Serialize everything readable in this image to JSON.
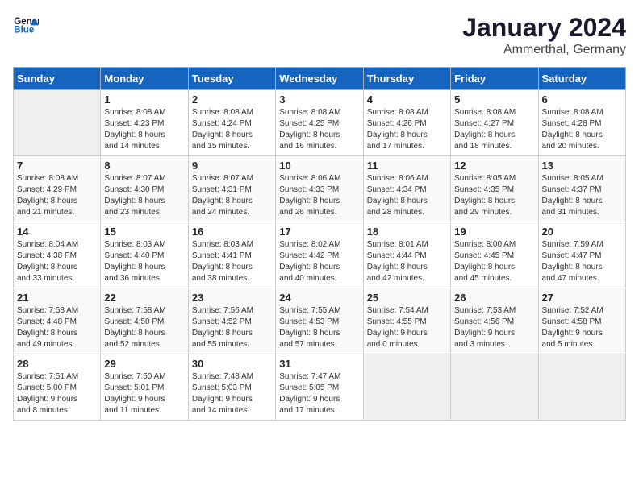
{
  "header": {
    "logo_general": "General",
    "logo_blue": "Blue",
    "title": "January 2024",
    "subtitle": "Ammerthal, Germany"
  },
  "days_of_week": [
    "Sunday",
    "Monday",
    "Tuesday",
    "Wednesday",
    "Thursday",
    "Friday",
    "Saturday"
  ],
  "weeks": [
    [
      {
        "day": "",
        "info": ""
      },
      {
        "day": "1",
        "info": "Sunrise: 8:08 AM\nSunset: 4:23 PM\nDaylight: 8 hours\nand 14 minutes."
      },
      {
        "day": "2",
        "info": "Sunrise: 8:08 AM\nSunset: 4:24 PM\nDaylight: 8 hours\nand 15 minutes."
      },
      {
        "day": "3",
        "info": "Sunrise: 8:08 AM\nSunset: 4:25 PM\nDaylight: 8 hours\nand 16 minutes."
      },
      {
        "day": "4",
        "info": "Sunrise: 8:08 AM\nSunset: 4:26 PM\nDaylight: 8 hours\nand 17 minutes."
      },
      {
        "day": "5",
        "info": "Sunrise: 8:08 AM\nSunset: 4:27 PM\nDaylight: 8 hours\nand 18 minutes."
      },
      {
        "day": "6",
        "info": "Sunrise: 8:08 AM\nSunset: 4:28 PM\nDaylight: 8 hours\nand 20 minutes."
      }
    ],
    [
      {
        "day": "7",
        "info": "Sunrise: 8:08 AM\nSunset: 4:29 PM\nDaylight: 8 hours\nand 21 minutes."
      },
      {
        "day": "8",
        "info": "Sunrise: 8:07 AM\nSunset: 4:30 PM\nDaylight: 8 hours\nand 23 minutes."
      },
      {
        "day": "9",
        "info": "Sunrise: 8:07 AM\nSunset: 4:31 PM\nDaylight: 8 hours\nand 24 minutes."
      },
      {
        "day": "10",
        "info": "Sunrise: 8:06 AM\nSunset: 4:33 PM\nDaylight: 8 hours\nand 26 minutes."
      },
      {
        "day": "11",
        "info": "Sunrise: 8:06 AM\nSunset: 4:34 PM\nDaylight: 8 hours\nand 28 minutes."
      },
      {
        "day": "12",
        "info": "Sunrise: 8:05 AM\nSunset: 4:35 PM\nDaylight: 8 hours\nand 29 minutes."
      },
      {
        "day": "13",
        "info": "Sunrise: 8:05 AM\nSunset: 4:37 PM\nDaylight: 8 hours\nand 31 minutes."
      }
    ],
    [
      {
        "day": "14",
        "info": "Sunrise: 8:04 AM\nSunset: 4:38 PM\nDaylight: 8 hours\nand 33 minutes."
      },
      {
        "day": "15",
        "info": "Sunrise: 8:03 AM\nSunset: 4:40 PM\nDaylight: 8 hours\nand 36 minutes."
      },
      {
        "day": "16",
        "info": "Sunrise: 8:03 AM\nSunset: 4:41 PM\nDaylight: 8 hours\nand 38 minutes."
      },
      {
        "day": "17",
        "info": "Sunrise: 8:02 AM\nSunset: 4:42 PM\nDaylight: 8 hours\nand 40 minutes."
      },
      {
        "day": "18",
        "info": "Sunrise: 8:01 AM\nSunset: 4:44 PM\nDaylight: 8 hours\nand 42 minutes."
      },
      {
        "day": "19",
        "info": "Sunrise: 8:00 AM\nSunset: 4:45 PM\nDaylight: 8 hours\nand 45 minutes."
      },
      {
        "day": "20",
        "info": "Sunrise: 7:59 AM\nSunset: 4:47 PM\nDaylight: 8 hours\nand 47 minutes."
      }
    ],
    [
      {
        "day": "21",
        "info": "Sunrise: 7:58 AM\nSunset: 4:48 PM\nDaylight: 8 hours\nand 49 minutes."
      },
      {
        "day": "22",
        "info": "Sunrise: 7:58 AM\nSunset: 4:50 PM\nDaylight: 8 hours\nand 52 minutes."
      },
      {
        "day": "23",
        "info": "Sunrise: 7:56 AM\nSunset: 4:52 PM\nDaylight: 8 hours\nand 55 minutes."
      },
      {
        "day": "24",
        "info": "Sunrise: 7:55 AM\nSunset: 4:53 PM\nDaylight: 8 hours\nand 57 minutes."
      },
      {
        "day": "25",
        "info": "Sunrise: 7:54 AM\nSunset: 4:55 PM\nDaylight: 9 hours\nand 0 minutes."
      },
      {
        "day": "26",
        "info": "Sunrise: 7:53 AM\nSunset: 4:56 PM\nDaylight: 9 hours\nand 3 minutes."
      },
      {
        "day": "27",
        "info": "Sunrise: 7:52 AM\nSunset: 4:58 PM\nDaylight: 9 hours\nand 5 minutes."
      }
    ],
    [
      {
        "day": "28",
        "info": "Sunrise: 7:51 AM\nSunset: 5:00 PM\nDaylight: 9 hours\nand 8 minutes."
      },
      {
        "day": "29",
        "info": "Sunrise: 7:50 AM\nSunset: 5:01 PM\nDaylight: 9 hours\nand 11 minutes."
      },
      {
        "day": "30",
        "info": "Sunrise: 7:48 AM\nSunset: 5:03 PM\nDaylight: 9 hours\nand 14 minutes."
      },
      {
        "day": "31",
        "info": "Sunrise: 7:47 AM\nSunset: 5:05 PM\nDaylight: 9 hours\nand 17 minutes."
      },
      {
        "day": "",
        "info": ""
      },
      {
        "day": "",
        "info": ""
      },
      {
        "day": "",
        "info": ""
      }
    ]
  ]
}
